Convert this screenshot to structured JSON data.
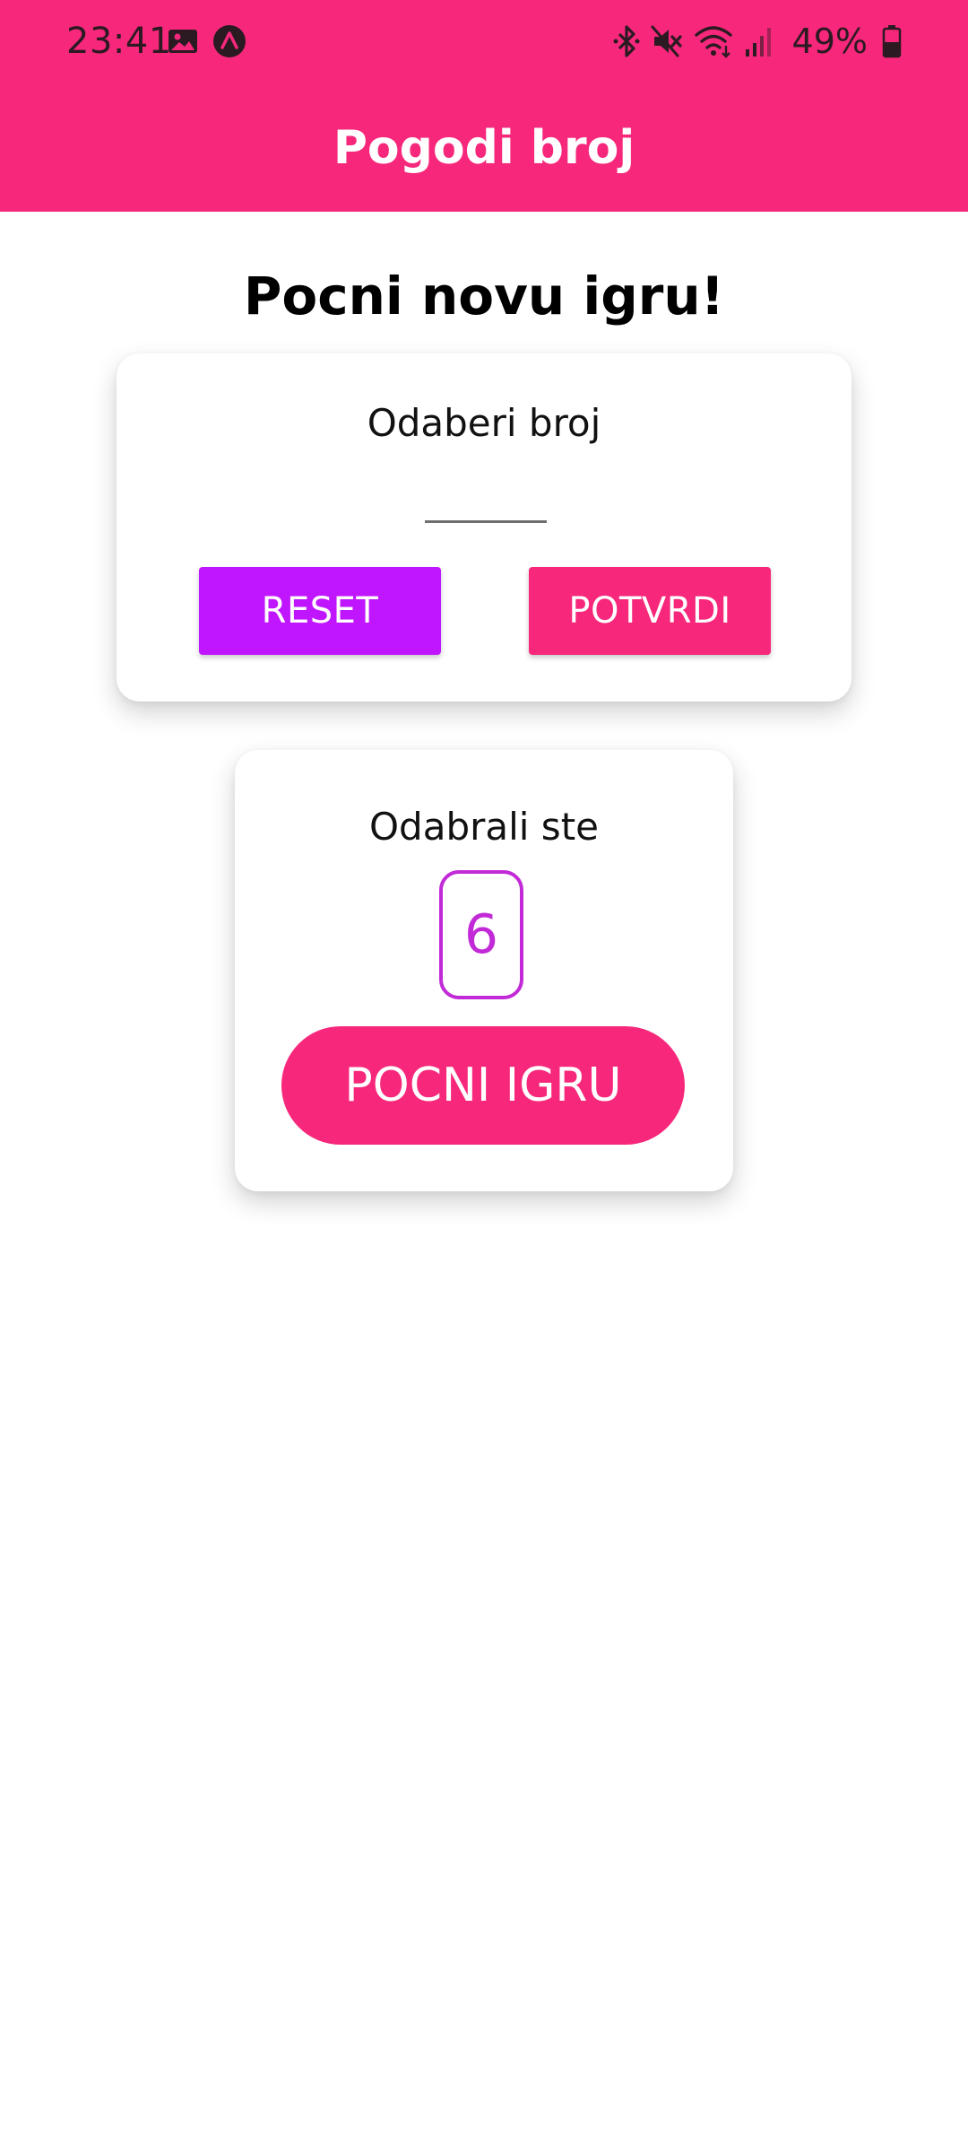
{
  "status_bar": {
    "time": "23:41",
    "left_icons": [
      "image-icon",
      "app-notification-icon"
    ],
    "right_icons": [
      "bluetooth-icon",
      "mute-icon",
      "wifi-icon",
      "signal-icon",
      "battery-icon"
    ],
    "battery": "49%"
  },
  "header": {
    "title": "Pogodi broj"
  },
  "main": {
    "heading": "Pocni novu igru!",
    "input_card": {
      "label": "Odaberi broj",
      "input_value": "",
      "reset_label": "RESET",
      "confirm_label": "POTVRDI"
    },
    "selected_card": {
      "label": "Odabrali ste",
      "number": "6",
      "start_label": "POCNI IGRU"
    }
  },
  "colors": {
    "primary": "#f7287b",
    "accent": "#c016ff",
    "number_border": "#c22ad8"
  }
}
